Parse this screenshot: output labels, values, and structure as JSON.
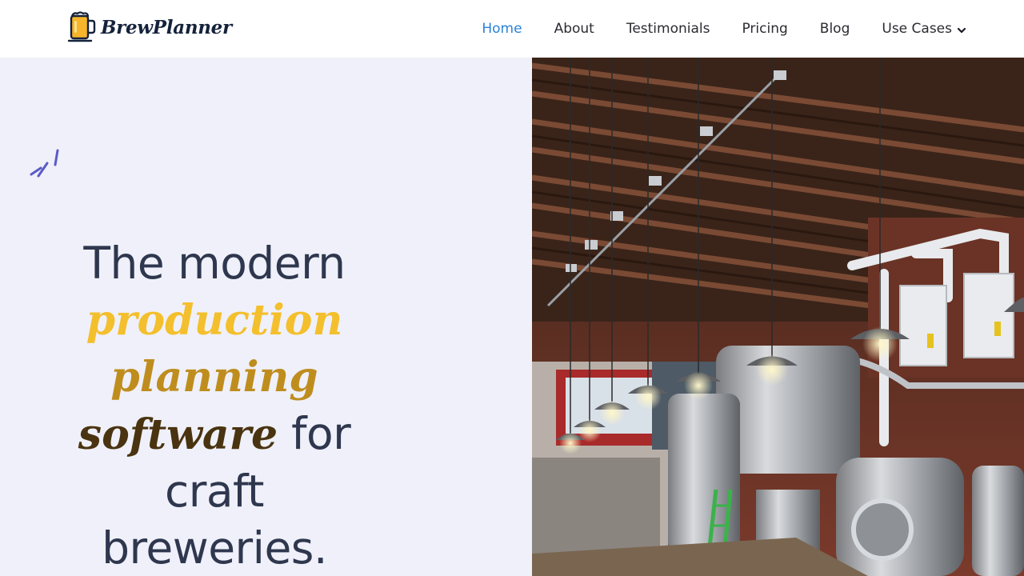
{
  "brand": {
    "name": "BrewPlanner",
    "logo_icon": "beer-mug-icon"
  },
  "nav": {
    "items": [
      {
        "label": "Home",
        "active": true
      },
      {
        "label": "About",
        "active": false
      },
      {
        "label": "Testimonials",
        "active": false
      },
      {
        "label": "Pricing",
        "active": false
      },
      {
        "label": "Blog",
        "active": false
      },
      {
        "label": "Use Cases",
        "active": false,
        "has_dropdown": true
      }
    ]
  },
  "hero": {
    "headline": {
      "line1": "The modern",
      "line2": "production",
      "line3": "planning",
      "line4_ital": "software",
      "line4_rest": " for",
      "line5": "craft",
      "line6": "breweries."
    },
    "image": "brewery-interior-photo"
  },
  "colors": {
    "nav_active": "#2b82d6",
    "hero_bg": "#eff0f9",
    "headline": "#2e374e",
    "accent_gold": "#f4bf2c",
    "accent_amber": "#bf8d1e",
    "accent_dark": "#4a3310",
    "deco_purple": "#5b5bc6"
  }
}
